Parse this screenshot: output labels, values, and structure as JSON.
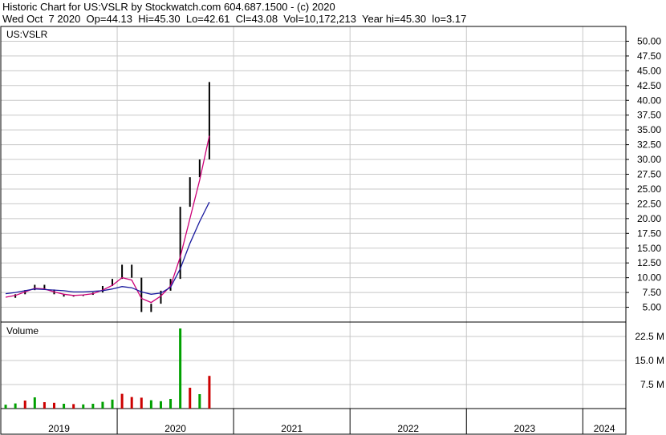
{
  "header": {
    "line1": "Historic Chart for US:VSLR by Stockwatch.com 604.687.1500 - (c) 2020",
    "line2": "Wed Oct  7 2020  Op=44.13  Hi=45.30  Lo=42.61  Cl=43.08  Vol=10,172,213  Year hi=45.30  lo=3.17"
  },
  "price_panel": {
    "symbol_label": "US:VSLR"
  },
  "volume_panel": {
    "label": "Volume"
  },
  "colors": {
    "candles": "#000000",
    "ma_short": "#cc0077",
    "ma_long": "#1a1a9e",
    "volume_up": "#00a000",
    "volume_down": "#cc0000",
    "grid": "#c8c8c8"
  },
  "chart_data": [
    {
      "type": "line",
      "title": "US:VSLR",
      "xlabel": "",
      "ylabel": "",
      "x_tick_labels": [
        "2019",
        "2020",
        "2021",
        "2022",
        "2023",
        "2024"
      ],
      "y_tick_labels": [
        "50.00",
        "47.50",
        "45.00",
        "42.50",
        "40.00",
        "37.50",
        "35.00",
        "32.50",
        "30.00",
        "27.50",
        "25.00",
        "22.50",
        "20.00",
        "17.50",
        "15.00",
        "12.50",
        "10.00",
        "7.50",
        "5.00"
      ],
      "ylim": [
        2.5,
        52.5
      ],
      "grid": true,
      "x": [
        "2019-01",
        "2019-02",
        "2019-03",
        "2019-04",
        "2019-05",
        "2019-06",
        "2019-07",
        "2019-08",
        "2019-09",
        "2019-10",
        "2019-11",
        "2019-12",
        "2020-01",
        "2020-02",
        "2020-03",
        "2020-04",
        "2020-05",
        "2020-06",
        "2020-07",
        "2020-08",
        "2020-09",
        "2020-10"
      ],
      "series": [
        {
          "values": [
            6.6,
            7.2,
            7.9,
            8.8,
            8.0,
            7.2,
            6.8,
            6.9,
            7.1,
            7.5,
            8.6,
            9.8,
            12.2,
            10.0,
            4.2,
            5.6,
            7.8,
            9.8,
            22.0,
            27.0,
            30.0,
            43.1
          ]
        },
        {
          "values": [
            6.7,
            7.0,
            7.6,
            8.2,
            8.1,
            7.6,
            7.2,
            7.0,
            7.1,
            7.3,
            7.9,
            8.7,
            10.0,
            9.6,
            6.5,
            5.8,
            6.9,
            8.6,
            13.5,
            20.0,
            26.5,
            34.0
          ]
        },
        {
          "values": [
            7.3,
            7.5,
            7.8,
            8.1,
            8.0,
            7.9,
            7.8,
            7.6,
            7.6,
            7.7,
            7.8,
            8.1,
            8.5,
            8.3,
            7.6,
            7.2,
            7.4,
            8.4,
            11.5,
            15.8,
            19.5,
            22.8
          ]
        }
      ]
    },
    {
      "type": "bar",
      "title": "Volume",
      "xlabel": "",
      "ylabel": "",
      "y_tick_labels": [
        "22.5 M",
        "15.0 M",
        "7.5 M"
      ],
      "ylim": [
        0,
        27
      ],
      "x": [
        "2019-01",
        "2019-02",
        "2019-03",
        "2019-04",
        "2019-05",
        "2019-06",
        "2019-07",
        "2019-08",
        "2019-09",
        "2019-10",
        "2019-11",
        "2019-12",
        "2020-01",
        "2020-02",
        "2020-03",
        "2020-04",
        "2020-05",
        "2020-06",
        "2020-07",
        "2020-08",
        "2020-09",
        "2020-10"
      ],
      "values": [
        1.2,
        1.6,
        2.5,
        3.5,
        2.0,
        1.8,
        1.5,
        1.4,
        1.3,
        1.5,
        2.1,
        2.8,
        4.6,
        3.6,
        3.4,
        2.6,
        2.3,
        3.0,
        25.0,
        6.5,
        4.5,
        10.2
      ],
      "up": [
        true,
        true,
        false,
        true,
        false,
        false,
        true,
        false,
        true,
        true,
        true,
        true,
        false,
        false,
        false,
        true,
        true,
        true,
        true,
        false,
        true,
        false
      ]
    }
  ]
}
